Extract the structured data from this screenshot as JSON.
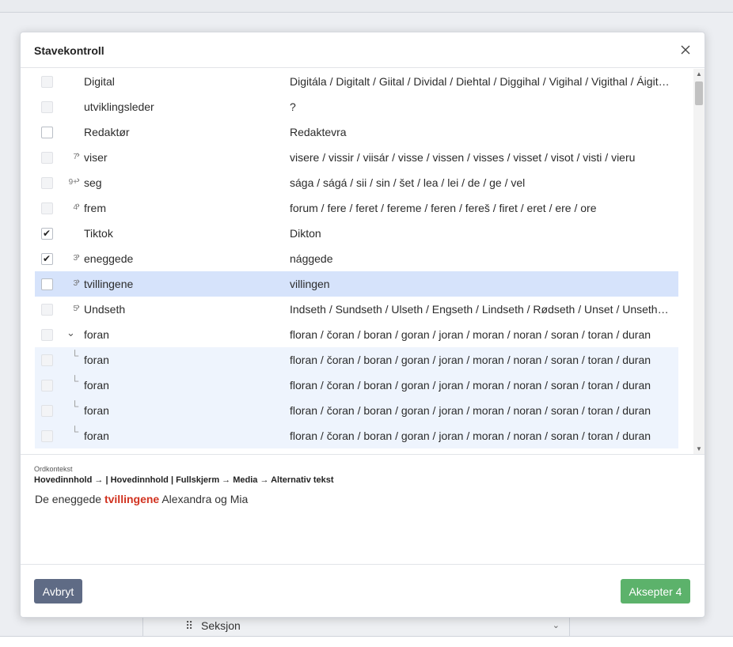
{
  "background": {
    "section_label": "Seksjon"
  },
  "modal": {
    "title": "Stavekontroll"
  },
  "rows": [
    {
      "word": "Digital",
      "suggestions": "Digitála / Digitalt / Giital / Dividal / Diehtal / Diggihal / Vigihal / Vigithal / Áigit…",
      "checked": false,
      "disabled": true,
      "count": ""
    },
    {
      "word": "utviklingsleder",
      "suggestions": "?",
      "checked": false,
      "disabled": true,
      "count": ""
    },
    {
      "word": "Redaktør",
      "suggestions": "Redaktevra",
      "checked": false,
      "disabled": false,
      "count": ""
    },
    {
      "word": "viser",
      "suggestions": "visere / vissir / viisár / visse / vissen / visses / visset / visot / visti / vieru",
      "checked": false,
      "disabled": true,
      "count": "7"
    },
    {
      "word": "seg",
      "suggestions": "sága / ságá / sii / sin / šet / lea / lei / de / ge / vel",
      "checked": false,
      "disabled": true,
      "count": "9+"
    },
    {
      "word": "frem",
      "suggestions": "forum / fere / feret / fereme / feren / fereš / firet / eret / ere / ore",
      "checked": false,
      "disabled": true,
      "count": "4"
    },
    {
      "word": "Tiktok",
      "suggestions": "Dikton",
      "checked": true,
      "disabled": false,
      "count": ""
    },
    {
      "word": "eneggede",
      "suggestions": "nággede",
      "checked": true,
      "disabled": false,
      "count": "3"
    },
    {
      "word": "tvillingene",
      "suggestions": "villingen",
      "checked": false,
      "disabled": false,
      "count": "3",
      "selected": true
    },
    {
      "word": "Undseth",
      "suggestions": "Indseth / Sundseth / Ulseth / Engseth / Lindseth / Rødseth / Unset / Unsethe…",
      "checked": false,
      "disabled": true,
      "count": "5"
    },
    {
      "word": "foran",
      "suggestions": "floran / čoran / boran / goran / joran / moran / noran / soran / toran / duran",
      "checked": false,
      "disabled": true,
      "count": "",
      "expanded": true
    },
    {
      "word": "foran",
      "suggestions": "floran / čoran / boran / goran / joran / moran / noran / soran / toran / duran",
      "checked": false,
      "disabled": true,
      "count": "",
      "child": true
    },
    {
      "word": "foran",
      "suggestions": "floran / čoran / boran / goran / joran / moran / noran / soran / toran / duran",
      "checked": false,
      "disabled": true,
      "count": "",
      "child": true
    },
    {
      "word": "foran",
      "suggestions": "floran / čoran / boran / goran / joran / moran / noran / soran / toran / duran",
      "checked": false,
      "disabled": true,
      "count": "",
      "child": true
    },
    {
      "word": "foran",
      "suggestions": "floran / čoran / boran / goran / joran / moran / noran / soran / toran / duran",
      "checked": false,
      "disabled": true,
      "count": "",
      "child": true
    }
  ],
  "context": {
    "label": "Ordkontekst",
    "path": "Hovedinnhold → | Hovedinnhold | Fullskjerm → Media → Alternativ tekst",
    "before": "De eneggede",
    "highlight": "tvillingene",
    "after": "Alexandra og Mia"
  },
  "footer": {
    "cancel_label": "Avbryt",
    "accept_label": "Aksepter 4"
  },
  "colors": {
    "selected_row": "#d6e3fb",
    "child_row": "#eef4fd",
    "highlight_text": "#d1321f",
    "cancel_button": "#5f6b85",
    "accept_button": "#5cb26b"
  },
  "icons": {
    "close": "close-icon",
    "grip": "drag-handle-icon",
    "chevron": "chevron-down-icon",
    "check": "checkmark-icon"
  }
}
